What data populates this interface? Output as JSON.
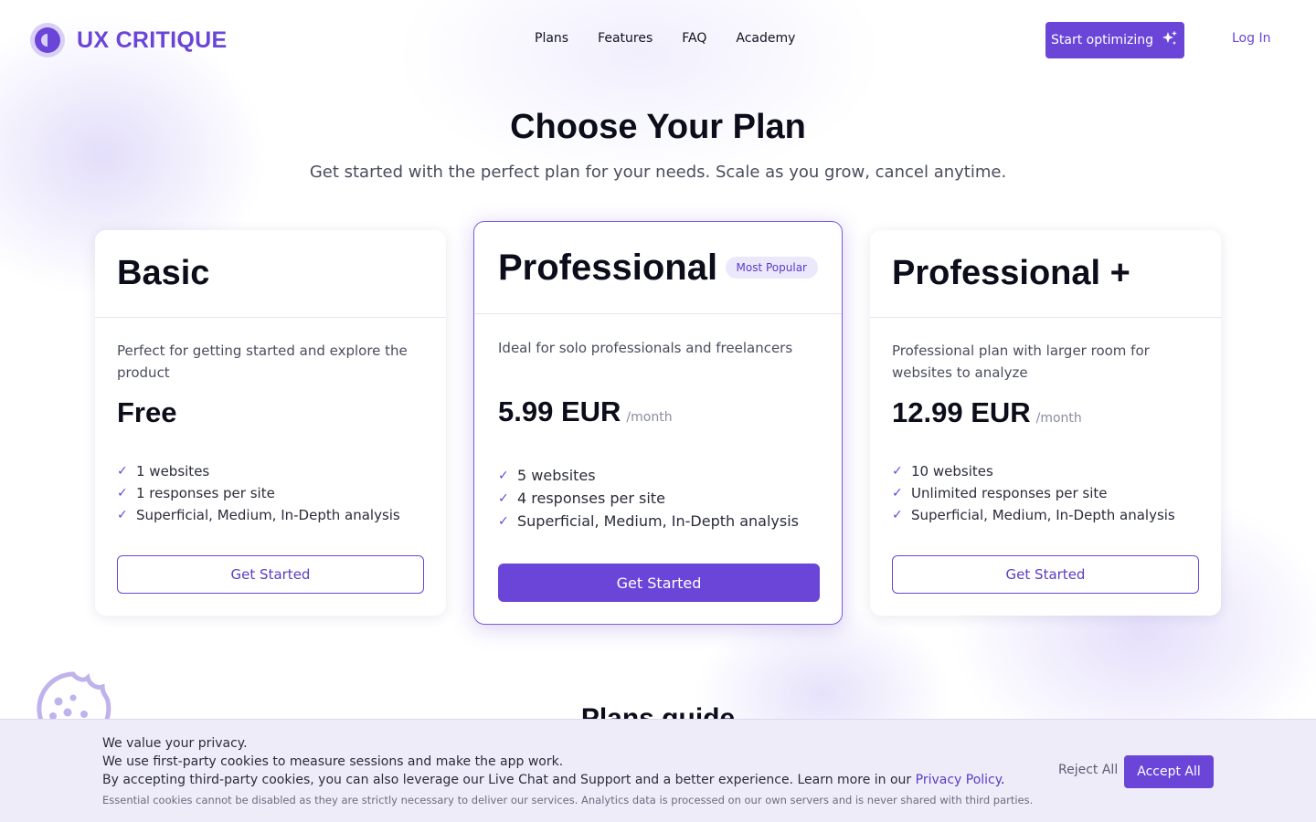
{
  "brand": {
    "name": "UX CRITIQUE",
    "color": "#6a45d8"
  },
  "nav": {
    "items": [
      {
        "label": "Plans"
      },
      {
        "label": "Features"
      },
      {
        "label": "FAQ"
      },
      {
        "label": "Academy"
      }
    ],
    "cta_label": "Start optimizing",
    "cta_icon": "sparkles-icon",
    "login_label": "Log In"
  },
  "hero": {
    "title": "Choose Your Plan",
    "subtitle": "Get started with the perfect plan for your needs. Scale as you grow, cancel anytime."
  },
  "plans": [
    {
      "name": "Basic",
      "description": "Perfect for getting started and explore the product",
      "price": "Free",
      "period": "",
      "features": [
        "1 websites",
        "1 responses per site",
        "Superficial, Medium, In-Depth analysis"
      ],
      "button": "Get Started"
    },
    {
      "name": "Professional",
      "badge": "Most Popular",
      "description": "Ideal for solo professionals and freelancers",
      "price": "5.99 EUR",
      "period": "/month",
      "features": [
        "5 websites",
        "4 responses per site",
        "Superficial, Medium, In-Depth analysis"
      ],
      "button": "Get Started"
    },
    {
      "name": "Professional +",
      "description": "Professional plan with larger room for websites to analyze",
      "price": "12.99 EUR",
      "period": "/month",
      "features": [
        "10 websites",
        "Unlimited responses per site",
        "Superficial, Medium, In-Depth analysis"
      ],
      "button": "Get Started"
    }
  ],
  "check_glyph": "✓",
  "section": {
    "plans_guide_title": "Plans guide"
  },
  "cookie": {
    "line1": "We value your privacy.",
    "line2": "We use first-party cookies to measure sessions and make the app work.",
    "line3_prefix": "By accepting third-party cookies, you can also leverage our Live Chat and Support and a better experience. Learn more in our ",
    "policy_link": "Privacy Policy",
    "line3_suffix": ".",
    "small": "Essential cookies cannot be disabled as they are strictly necessary to deliver our services. Analytics data is processed on our own servers and is never shared with third parties.",
    "reject_label": "Reject All",
    "accept_label": "Accept All"
  }
}
